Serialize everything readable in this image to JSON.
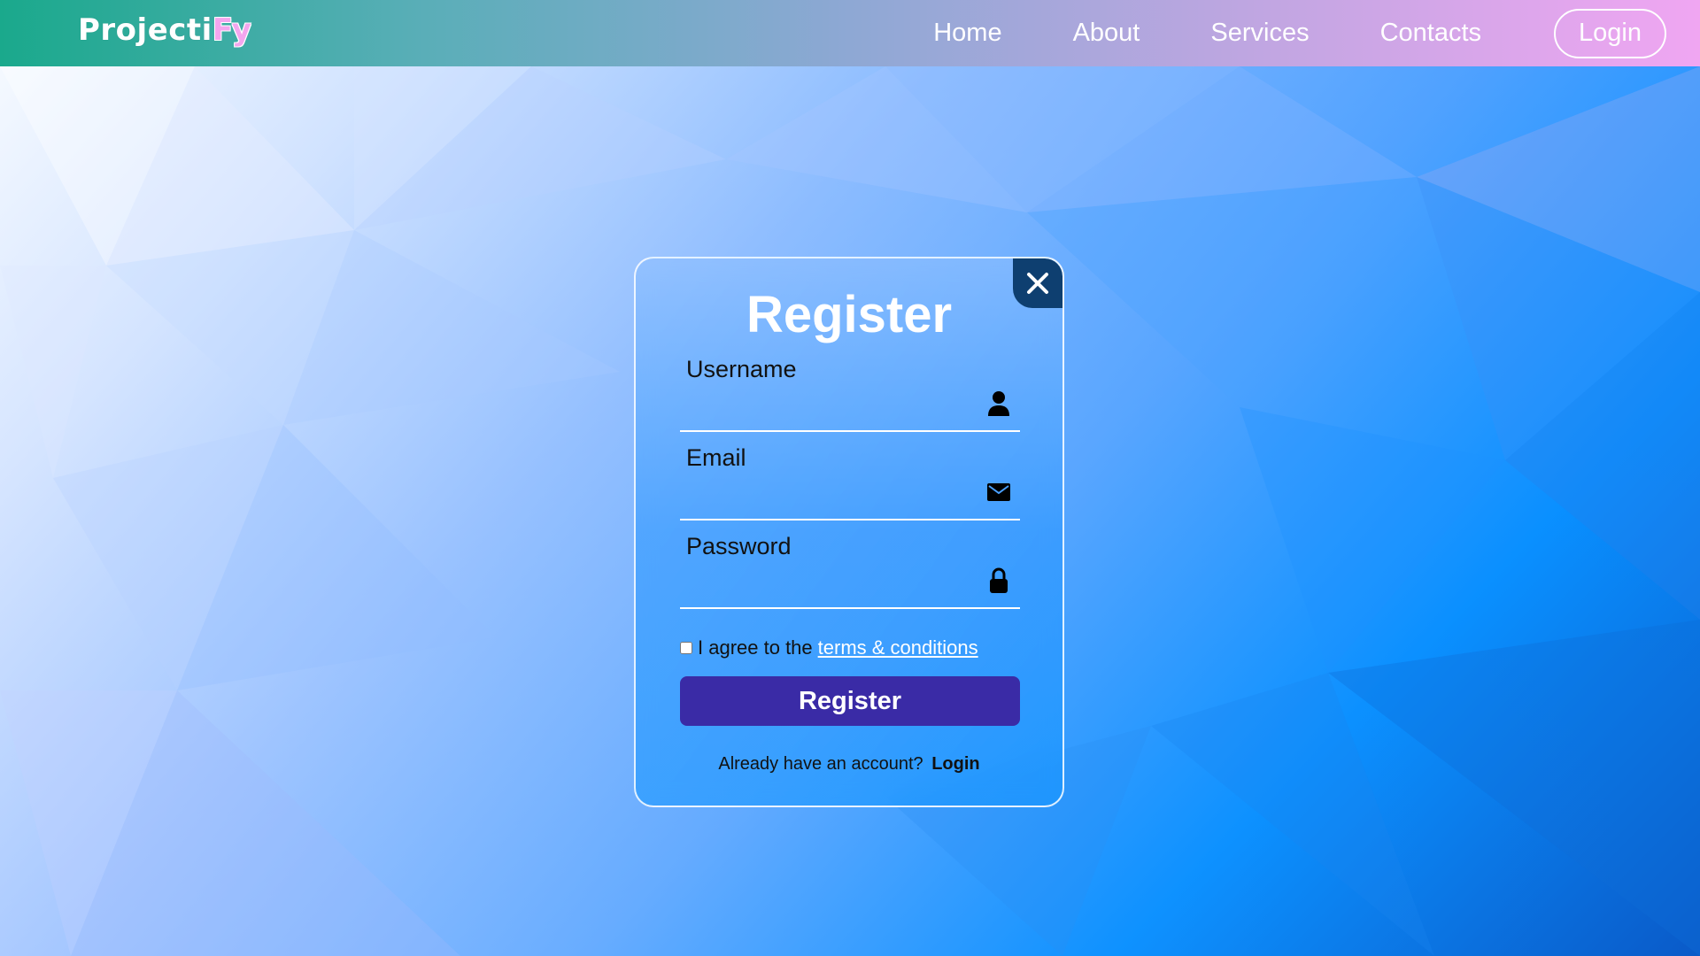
{
  "header": {
    "logo_main": "Projecti",
    "logo_accent": "Fy",
    "nav": [
      "Home",
      "About",
      "Services",
      "Contacts"
    ],
    "login_label": "Login"
  },
  "modal": {
    "title": "Register",
    "close_icon": "close-icon",
    "fields": {
      "username": {
        "label": "Username",
        "value": "",
        "icon": "user-icon"
      },
      "email": {
        "label": "Email",
        "value": "",
        "icon": "mail-icon"
      },
      "password": {
        "label": "Password",
        "value": "",
        "icon": "lock-icon"
      }
    },
    "agree_text": "I agree to the",
    "terms_link": "terms & conditions",
    "agree_checked": false,
    "submit_label": "Register",
    "footer_text": "Already have an account?",
    "footer_link": "Login"
  },
  "colors": {
    "header_gradient_start": "#1aa98c",
    "header_gradient_end": "#f0a6f2",
    "submit_button": "#3a2ba6",
    "close_button": "#0e3f70",
    "logo_accent": "#f3a6ee"
  }
}
